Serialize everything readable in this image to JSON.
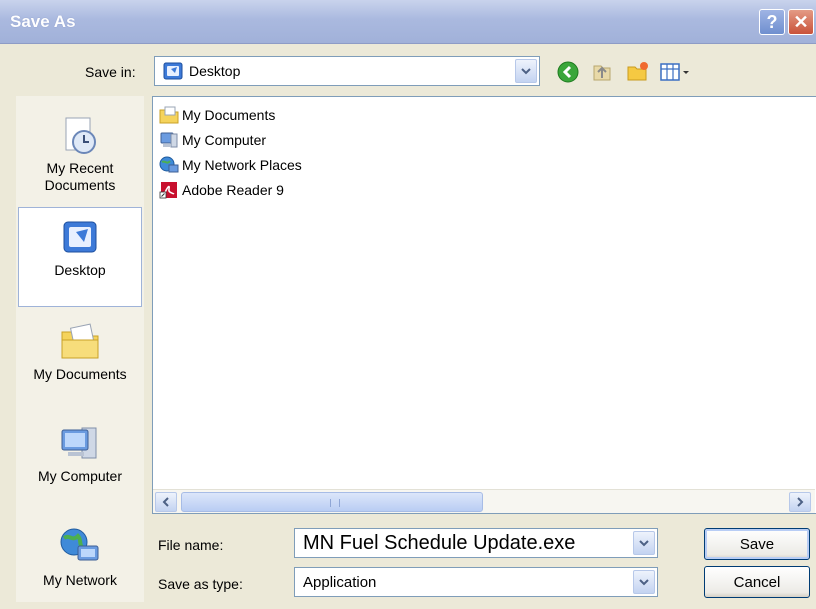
{
  "window": {
    "title": "Save As"
  },
  "save_in": {
    "label": "Save in:",
    "value": "Desktop"
  },
  "places": [
    {
      "label": "My Recent Documents",
      "line1": "My Recent",
      "line2": "Documents"
    },
    {
      "label": "Desktop",
      "selected": true
    },
    {
      "label": "My Documents"
    },
    {
      "label": "My Computer"
    },
    {
      "label": "My Network"
    }
  ],
  "files": [
    {
      "name": "My Documents",
      "icon": "folder-documents-icon"
    },
    {
      "name": "My Computer",
      "icon": "computer-icon"
    },
    {
      "name": "My Network Places",
      "icon": "network-places-icon"
    },
    {
      "name": "Adobe Reader 9",
      "icon": "adobe-reader-shortcut-icon"
    }
  ],
  "file_name": {
    "label": "File name:",
    "value": "MN Fuel Schedule Update.exe"
  },
  "save_as_type": {
    "label": "Save as type:",
    "value": "Application"
  },
  "buttons": {
    "save": "Save",
    "cancel": "Cancel"
  },
  "colors": {
    "title_bar": "#a9b8df",
    "dialog_bg": "#ece9d8",
    "close_button": "#c9523a"
  }
}
